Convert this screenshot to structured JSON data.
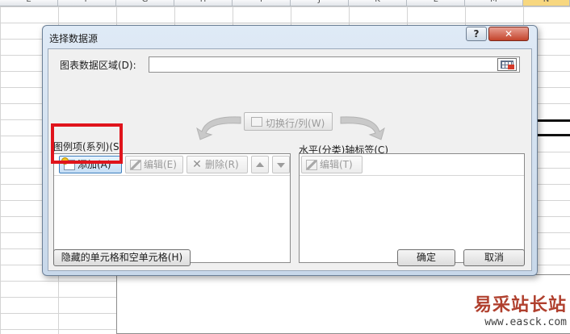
{
  "sheet": {
    "columns": [
      "E",
      "F",
      "G",
      "H",
      "I",
      "J",
      "K",
      "L",
      "M",
      "N"
    ]
  },
  "dialog": {
    "title": "选择数据源",
    "help_label": "?",
    "close_label": "✕",
    "range_label": "图表数据区域(D):",
    "range_value": "",
    "switch_label": "切换行/列(W)",
    "legend_section_label": "图例项(系列)(S)",
    "axis_section_label": "水平(分类)轴标签(C)",
    "legend_toolbar": {
      "add": "添加(A)",
      "edit": "编辑(E)",
      "delete": "删除(R)"
    },
    "axis_toolbar": {
      "edit": "编辑(T)"
    },
    "hidden_cells_label": "隐藏的单元格和空单元格(H)",
    "ok_label": "确定",
    "cancel_label": "取消"
  },
  "watermark": {
    "title": "易采站长站",
    "url": "www.easck.com"
  },
  "colors": {
    "highlight": "#e0141c",
    "title_bar": "#dfeaf6",
    "close_button": "#c3432b"
  }
}
